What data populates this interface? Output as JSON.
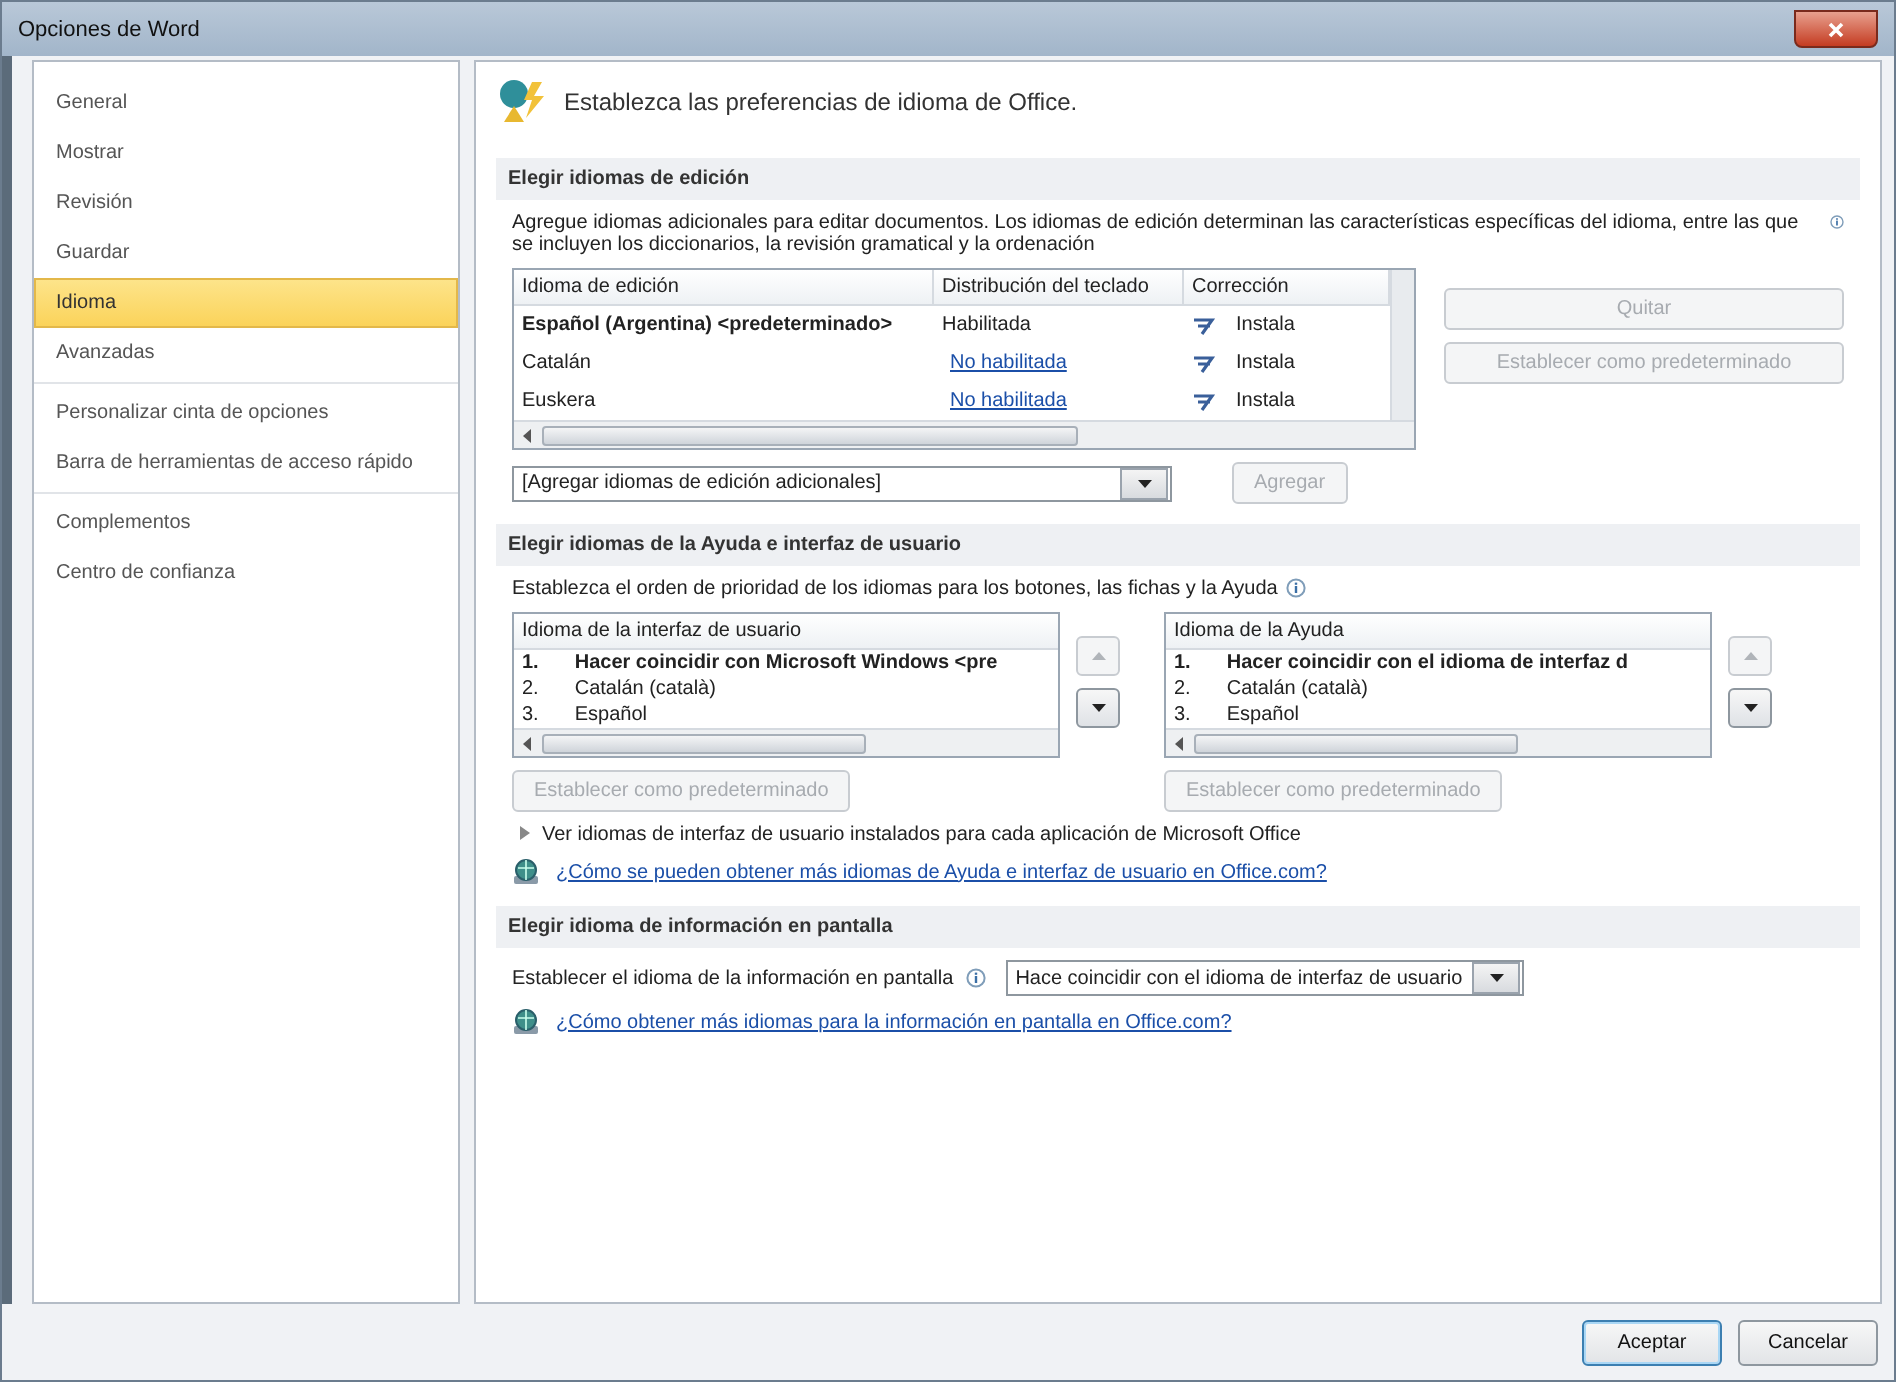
{
  "window": {
    "title": "Opciones de Word"
  },
  "sidebar": {
    "groups": [
      [
        {
          "label": "General",
          "selected": false
        },
        {
          "label": "Mostrar",
          "selected": false
        },
        {
          "label": "Revisión",
          "selected": false
        },
        {
          "label": "Guardar",
          "selected": false
        },
        {
          "label": "Idioma",
          "selected": true
        },
        {
          "label": "Avanzadas",
          "selected": false
        }
      ],
      [
        {
          "label": "Personalizar cinta de opciones",
          "selected": false
        },
        {
          "label": "Barra de herramientas de acceso rápido",
          "selected": false
        }
      ],
      [
        {
          "label": "Complementos",
          "selected": false
        },
        {
          "label": "Centro de confianza",
          "selected": false
        }
      ]
    ]
  },
  "header": "Establezca las preferencias de idioma de Office.",
  "editing": {
    "title": "Elegir idiomas de edición",
    "description": "Agregue idiomas adicionales para editar documentos. Los idiomas de edición determinan las características específicas del idioma, entre las que se incluyen los diccionarios, la revisión gramatical y la ordenación",
    "columns": [
      "Idioma de edición",
      "Distribución del teclado",
      "Corrección"
    ],
    "rows": [
      {
        "language": "Español (Argentina) <predeterminado>",
        "default": true,
        "keyboard": "Habilitada",
        "keyboard_enabled": true,
        "proofing": "Instala"
      },
      {
        "language": "Catalán",
        "default": false,
        "keyboard": "No habilitada",
        "keyboard_enabled": false,
        "proofing": "Instala"
      },
      {
        "language": "Euskera",
        "default": false,
        "keyboard": "No habilitada",
        "keyboard_enabled": false,
        "proofing": "Instala"
      }
    ],
    "side_buttons": [
      {
        "label": "Quitar",
        "disabled": true
      },
      {
        "label": "Establecer como predeterminado",
        "disabled": true
      }
    ],
    "add_dropdown": "[Agregar idiomas de edición adicionales]",
    "add_button": {
      "label": "Agregar",
      "disabled": true
    }
  },
  "ui": {
    "title": "Elegir idiomas de la Ayuda e interfaz de usuario",
    "description": "Establezca el orden de prioridad de los idiomas para los botones, las fichas y la Ayuda",
    "lists": [
      {
        "header": "Idioma de la interfaz de usuario",
        "items": [
          {
            "number": "1.",
            "label": "Hacer coincidir con Microsoft Windows <pre",
            "default": true
          },
          {
            "number": "2.",
            "label": "Catalán (català)",
            "default": false
          },
          {
            "number": "3.",
            "label": "Español",
            "default": false
          }
        ],
        "up_disabled": true,
        "down_disabled": false,
        "button": {
          "label": "Establecer como predeterminado",
          "disabled": true
        }
      },
      {
        "header": "Idioma de la Ayuda",
        "items": [
          {
            "number": "1.",
            "label": "Hacer coincidir con el idioma de interfaz d",
            "default": true
          },
          {
            "number": "2.",
            "label": "Catalán (català)",
            "default": false
          },
          {
            "number": "3.",
            "label": "Español",
            "default": false
          }
        ],
        "up_disabled": true,
        "down_disabled": false,
        "button": {
          "label": "Establecer como predeterminado",
          "disabled": true
        }
      }
    ],
    "expander": "Ver idiomas de interfaz de usuario instalados para cada aplicación de Microsoft Office",
    "link": "¿Cómo se pueden obtener más idiomas de Ayuda e interfaz de usuario en Office.com?"
  },
  "screentip": {
    "title": "Elegir idioma de información en pantalla",
    "label": "Establecer el idioma de la información en pantalla",
    "dropdown": "Hace coincidir con el idioma de interfaz de usuario",
    "link": "¿Cómo obtener más idiomas para la información en pantalla en Office.com?"
  },
  "footer_buttons": [
    {
      "label": "Aceptar",
      "default": true
    },
    {
      "label": "Cancelar",
      "default": false
    }
  ]
}
